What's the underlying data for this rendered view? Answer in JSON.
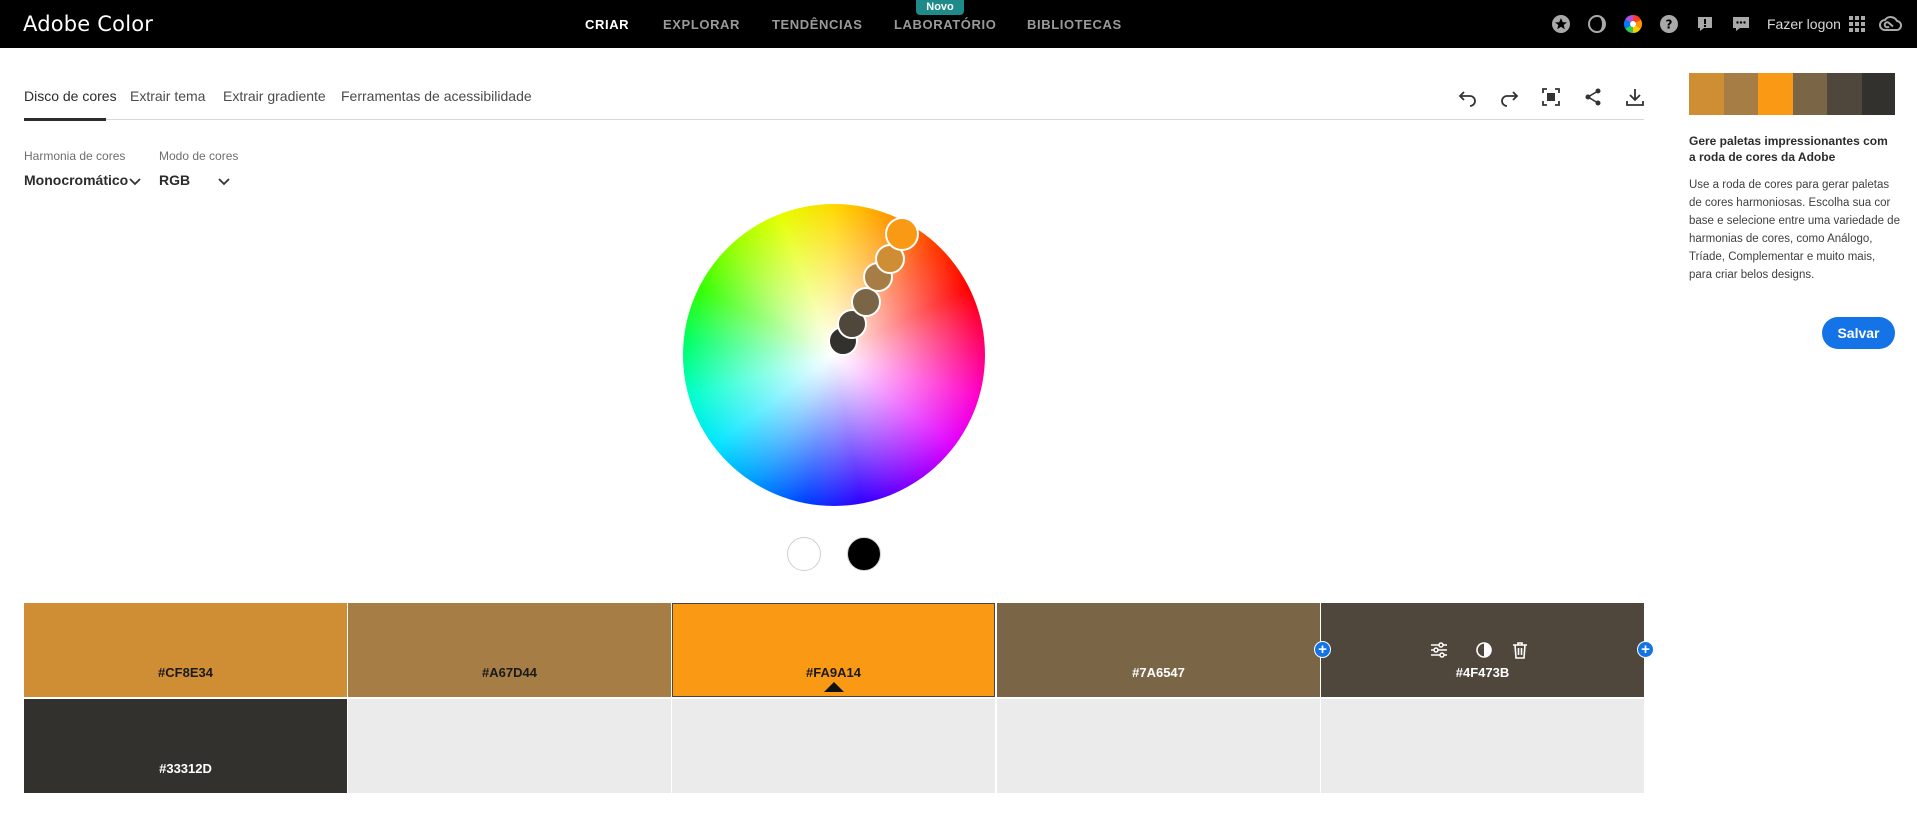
{
  "app": {
    "title": "Adobe Color"
  },
  "nav": {
    "items": [
      {
        "label": "CRIAR",
        "active": true
      },
      {
        "label": "EXPLORAR"
      },
      {
        "label": "TENDÊNCIAS"
      },
      {
        "label": "LABORATÓRIO"
      },
      {
        "label": "BIBLIOTECAS"
      }
    ],
    "badge": "Novo",
    "signin": "Fazer logon",
    "icons": [
      "star-icon",
      "dark-mode-icon",
      "color-wheel-icon",
      "help-icon",
      "feedback-icon",
      "chat-icon",
      "apps-grid-icon",
      "creative-cloud-icon"
    ]
  },
  "tabs": [
    {
      "label": "Disco de cores",
      "active": true
    },
    {
      "label": "Extrair tema"
    },
    {
      "label": "Extrair gradiente"
    },
    {
      "label": "Ferramentas de acessibilidade"
    }
  ],
  "toolbar_icons": [
    "undo-icon",
    "redo-icon",
    "fullscreen-icon",
    "share-icon",
    "download-icon"
  ],
  "harmony": {
    "label": "Harmonia de cores",
    "value": "Monocromático"
  },
  "mode": {
    "label": "Modo de cores",
    "value": "RGB"
  },
  "swatches": [
    {
      "hex": "#CF8E34",
      "color": "#cf8e34",
      "text_color": "#1a1a1a"
    },
    {
      "hex": "#A67D44",
      "color": "#a67d44",
      "text_color": "#1a1a1a"
    },
    {
      "hex": "#FA9A14",
      "color": "#fa9a14",
      "text_color": "#1a1a1a",
      "selected": true
    },
    {
      "hex": "#7A6547",
      "color": "#7a6547",
      "text_color": "#ffffff"
    },
    {
      "hex": "#4F473B",
      "color": "#4f473b",
      "text_color": "#ffffff"
    },
    {
      "hex": "#33312D",
      "color": "#33312d",
      "text_color": "#ffffff"
    }
  ],
  "panel": {
    "title": "Gere paletas impressionantes com a roda de cores da Adobe",
    "text": "Use a roda de cores para gerar paletas de cores harmoniosas. Escolha sua cor base e selecione entre uma variedade de harmonias de cores, como Análogo, Tríade, Complementar e muito mais, para criar belos designs.",
    "save_label": "Salvar"
  }
}
